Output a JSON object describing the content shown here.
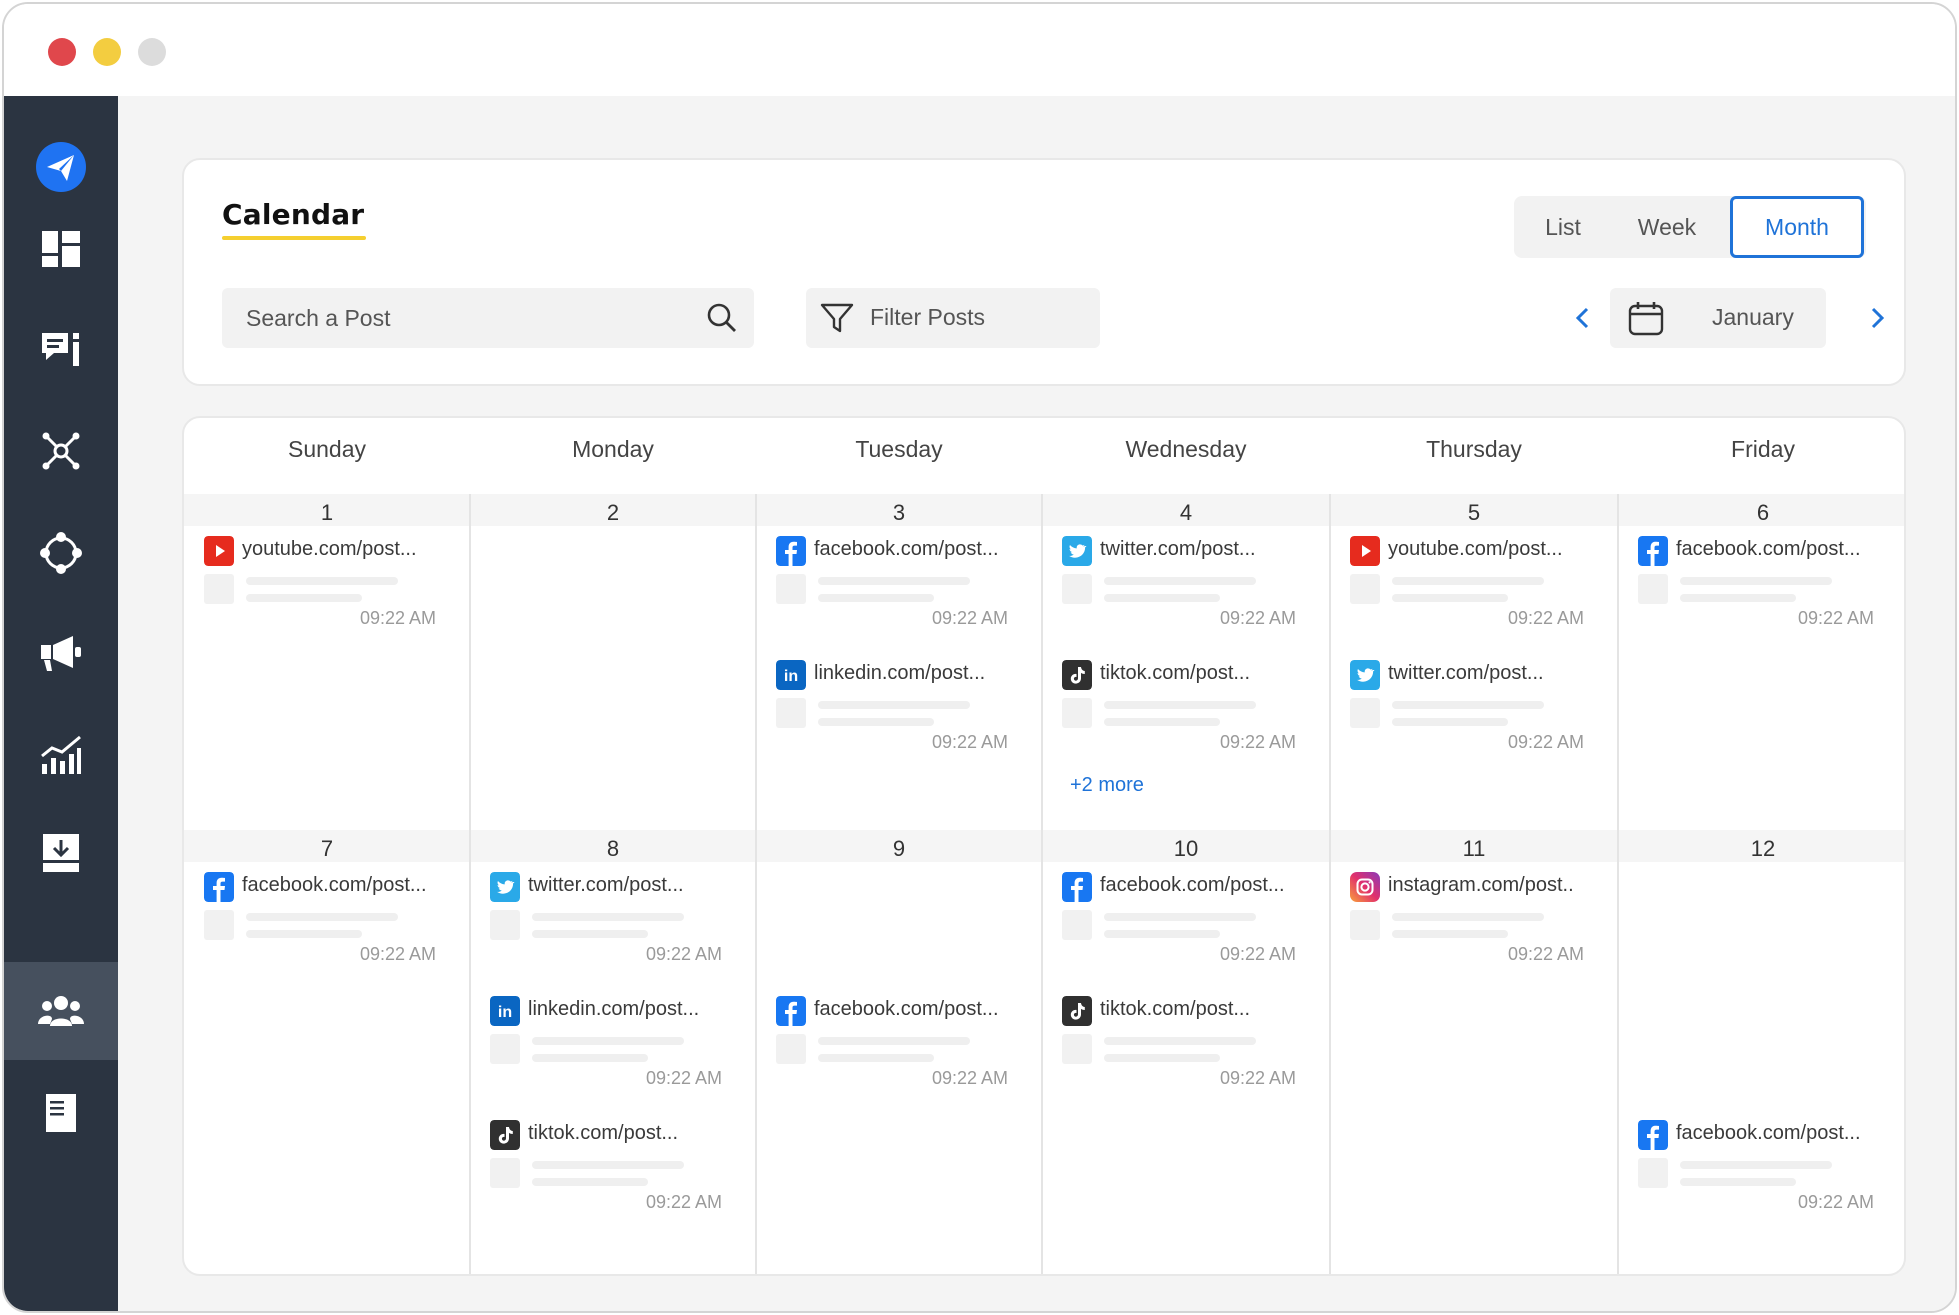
{
  "window": {
    "controls": [
      "close",
      "minimize",
      "maximize"
    ]
  },
  "colors": {
    "accent": "#1f73d8",
    "sidebar": "#2b3441",
    "underline": "#f5cf2f"
  },
  "sidebar": {
    "items": [
      {
        "name": "send-logo-icon",
        "active": false
      },
      {
        "name": "dashboard-icon",
        "active": false
      },
      {
        "name": "messages-icon",
        "active": false
      },
      {
        "name": "network-icon",
        "active": false
      },
      {
        "name": "integrations-icon",
        "active": false
      },
      {
        "name": "megaphone-icon",
        "active": false
      },
      {
        "name": "analytics-icon",
        "active": false
      },
      {
        "name": "inbox-download-icon",
        "active": false
      },
      {
        "name": "team-icon",
        "active": true
      },
      {
        "name": "document-icon",
        "active": false
      }
    ]
  },
  "header": {
    "title": "Calendar",
    "views": {
      "list": "List",
      "week": "Week",
      "month": "Month",
      "selected": "Month"
    },
    "search": {
      "placeholder": "Search a Post"
    },
    "filter": {
      "label": "Filter Posts"
    },
    "month": {
      "label": "January"
    }
  },
  "calendar": {
    "days": [
      "Sunday",
      "Monday",
      "Tuesday",
      "Wednesday",
      "Thursday",
      "Friday"
    ],
    "weeks": [
      {
        "dates": [
          "1",
          "2",
          "3",
          "4",
          "5",
          "6"
        ],
        "cells": [
          {
            "posts": [
              {
                "platform": "youtube",
                "url": "youtube.com/post...",
                "time": "09:22 AM"
              }
            ]
          },
          {
            "posts": []
          },
          {
            "posts": [
              {
                "platform": "facebook",
                "url": "facebook.com/post...",
                "time": "09:22 AM"
              },
              {
                "platform": "linkedin",
                "url": "linkedin.com/post...",
                "time": "09:22 AM"
              }
            ]
          },
          {
            "posts": [
              {
                "platform": "twitter",
                "url": "twitter.com/post...",
                "time": "09:22 AM"
              },
              {
                "platform": "tiktok",
                "url": "tiktok.com/post...",
                "time": "09:22 AM"
              }
            ],
            "more": "+2 more"
          },
          {
            "posts": [
              {
                "platform": "youtube",
                "url": "youtube.com/post...",
                "time": "09:22 AM"
              },
              {
                "platform": "twitter",
                "url": "twitter.com/post...",
                "time": "09:22 AM"
              }
            ]
          },
          {
            "posts": [
              {
                "platform": "facebook",
                "url": "facebook.com/post...",
                "time": "09:22 AM"
              }
            ]
          }
        ]
      },
      {
        "dates": [
          "7",
          "8",
          "9",
          "10",
          "11",
          "12"
        ],
        "cells": [
          {
            "posts": [
              {
                "platform": "facebook",
                "url": "facebook.com/post...",
                "time": "09:22 AM"
              }
            ]
          },
          {
            "posts": [
              {
                "platform": "twitter",
                "url": "twitter.com/post...",
                "time": "09:22 AM"
              },
              {
                "platform": "linkedin",
                "url": "linkedin.com/post...",
                "time": "09:22 AM"
              },
              {
                "platform": "tiktok",
                "url": "tiktok.com/post...",
                "time": "09:22 AM"
              }
            ]
          },
          {
            "posts": [
              {
                "platform": "facebook",
                "url": "facebook.com/post...",
                "time": "09:22 AM",
                "slot": 1
              }
            ]
          },
          {
            "posts": [
              {
                "platform": "facebook",
                "url": "facebook.com/post...",
                "time": "09:22 AM"
              },
              {
                "platform": "tiktok",
                "url": "tiktok.com/post...",
                "time": "09:22 AM"
              }
            ]
          },
          {
            "posts": [
              {
                "platform": "instagram",
                "url": "instagram.com/post..",
                "time": "09:22 AM"
              }
            ]
          },
          {
            "posts": [
              {
                "platform": "facebook",
                "url": "facebook.com/post...",
                "time": "09:22 AM",
                "slot": 2
              }
            ]
          }
        ]
      }
    ]
  }
}
